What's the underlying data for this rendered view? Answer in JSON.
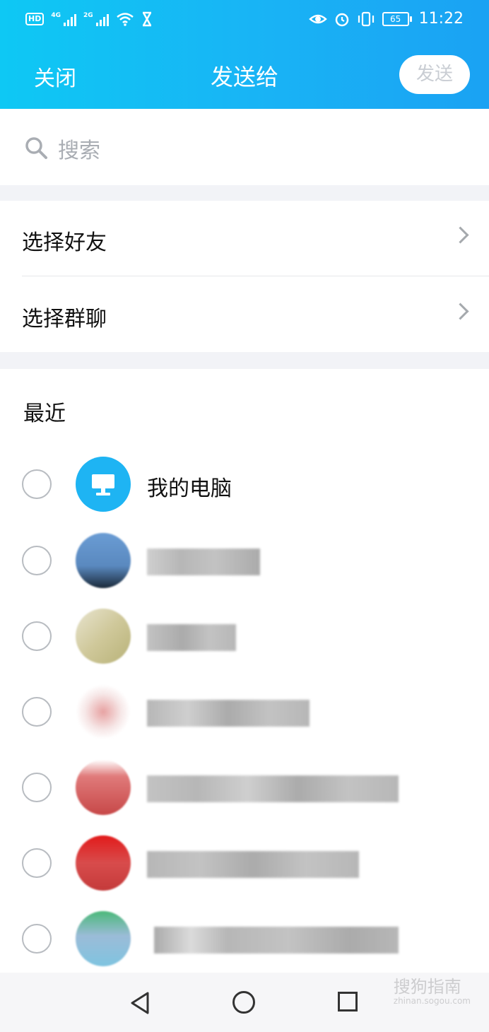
{
  "status_bar": {
    "network_gen_1": "4G",
    "network_gen_2": "2G",
    "battery_level": "65",
    "time": "11:22"
  },
  "header": {
    "close_label": "关闭",
    "title": "发送给",
    "send_label": "发送"
  },
  "search": {
    "placeholder": "搜索"
  },
  "options": [
    {
      "label": "选择好友"
    },
    {
      "label": "选择群聊"
    }
  ],
  "recent": {
    "heading": "最近",
    "contacts": [
      {
        "name": "我的电脑"
      }
    ]
  },
  "watermark": {
    "text": "搜狗指南",
    "sub": "zhinan.sogou.com"
  },
  "colors": {
    "header_start": "#0ec8f4",
    "header_end": "#1aa2f3",
    "pc_avatar": "#1eb4f3",
    "section_gap": "#f2f3f7"
  }
}
